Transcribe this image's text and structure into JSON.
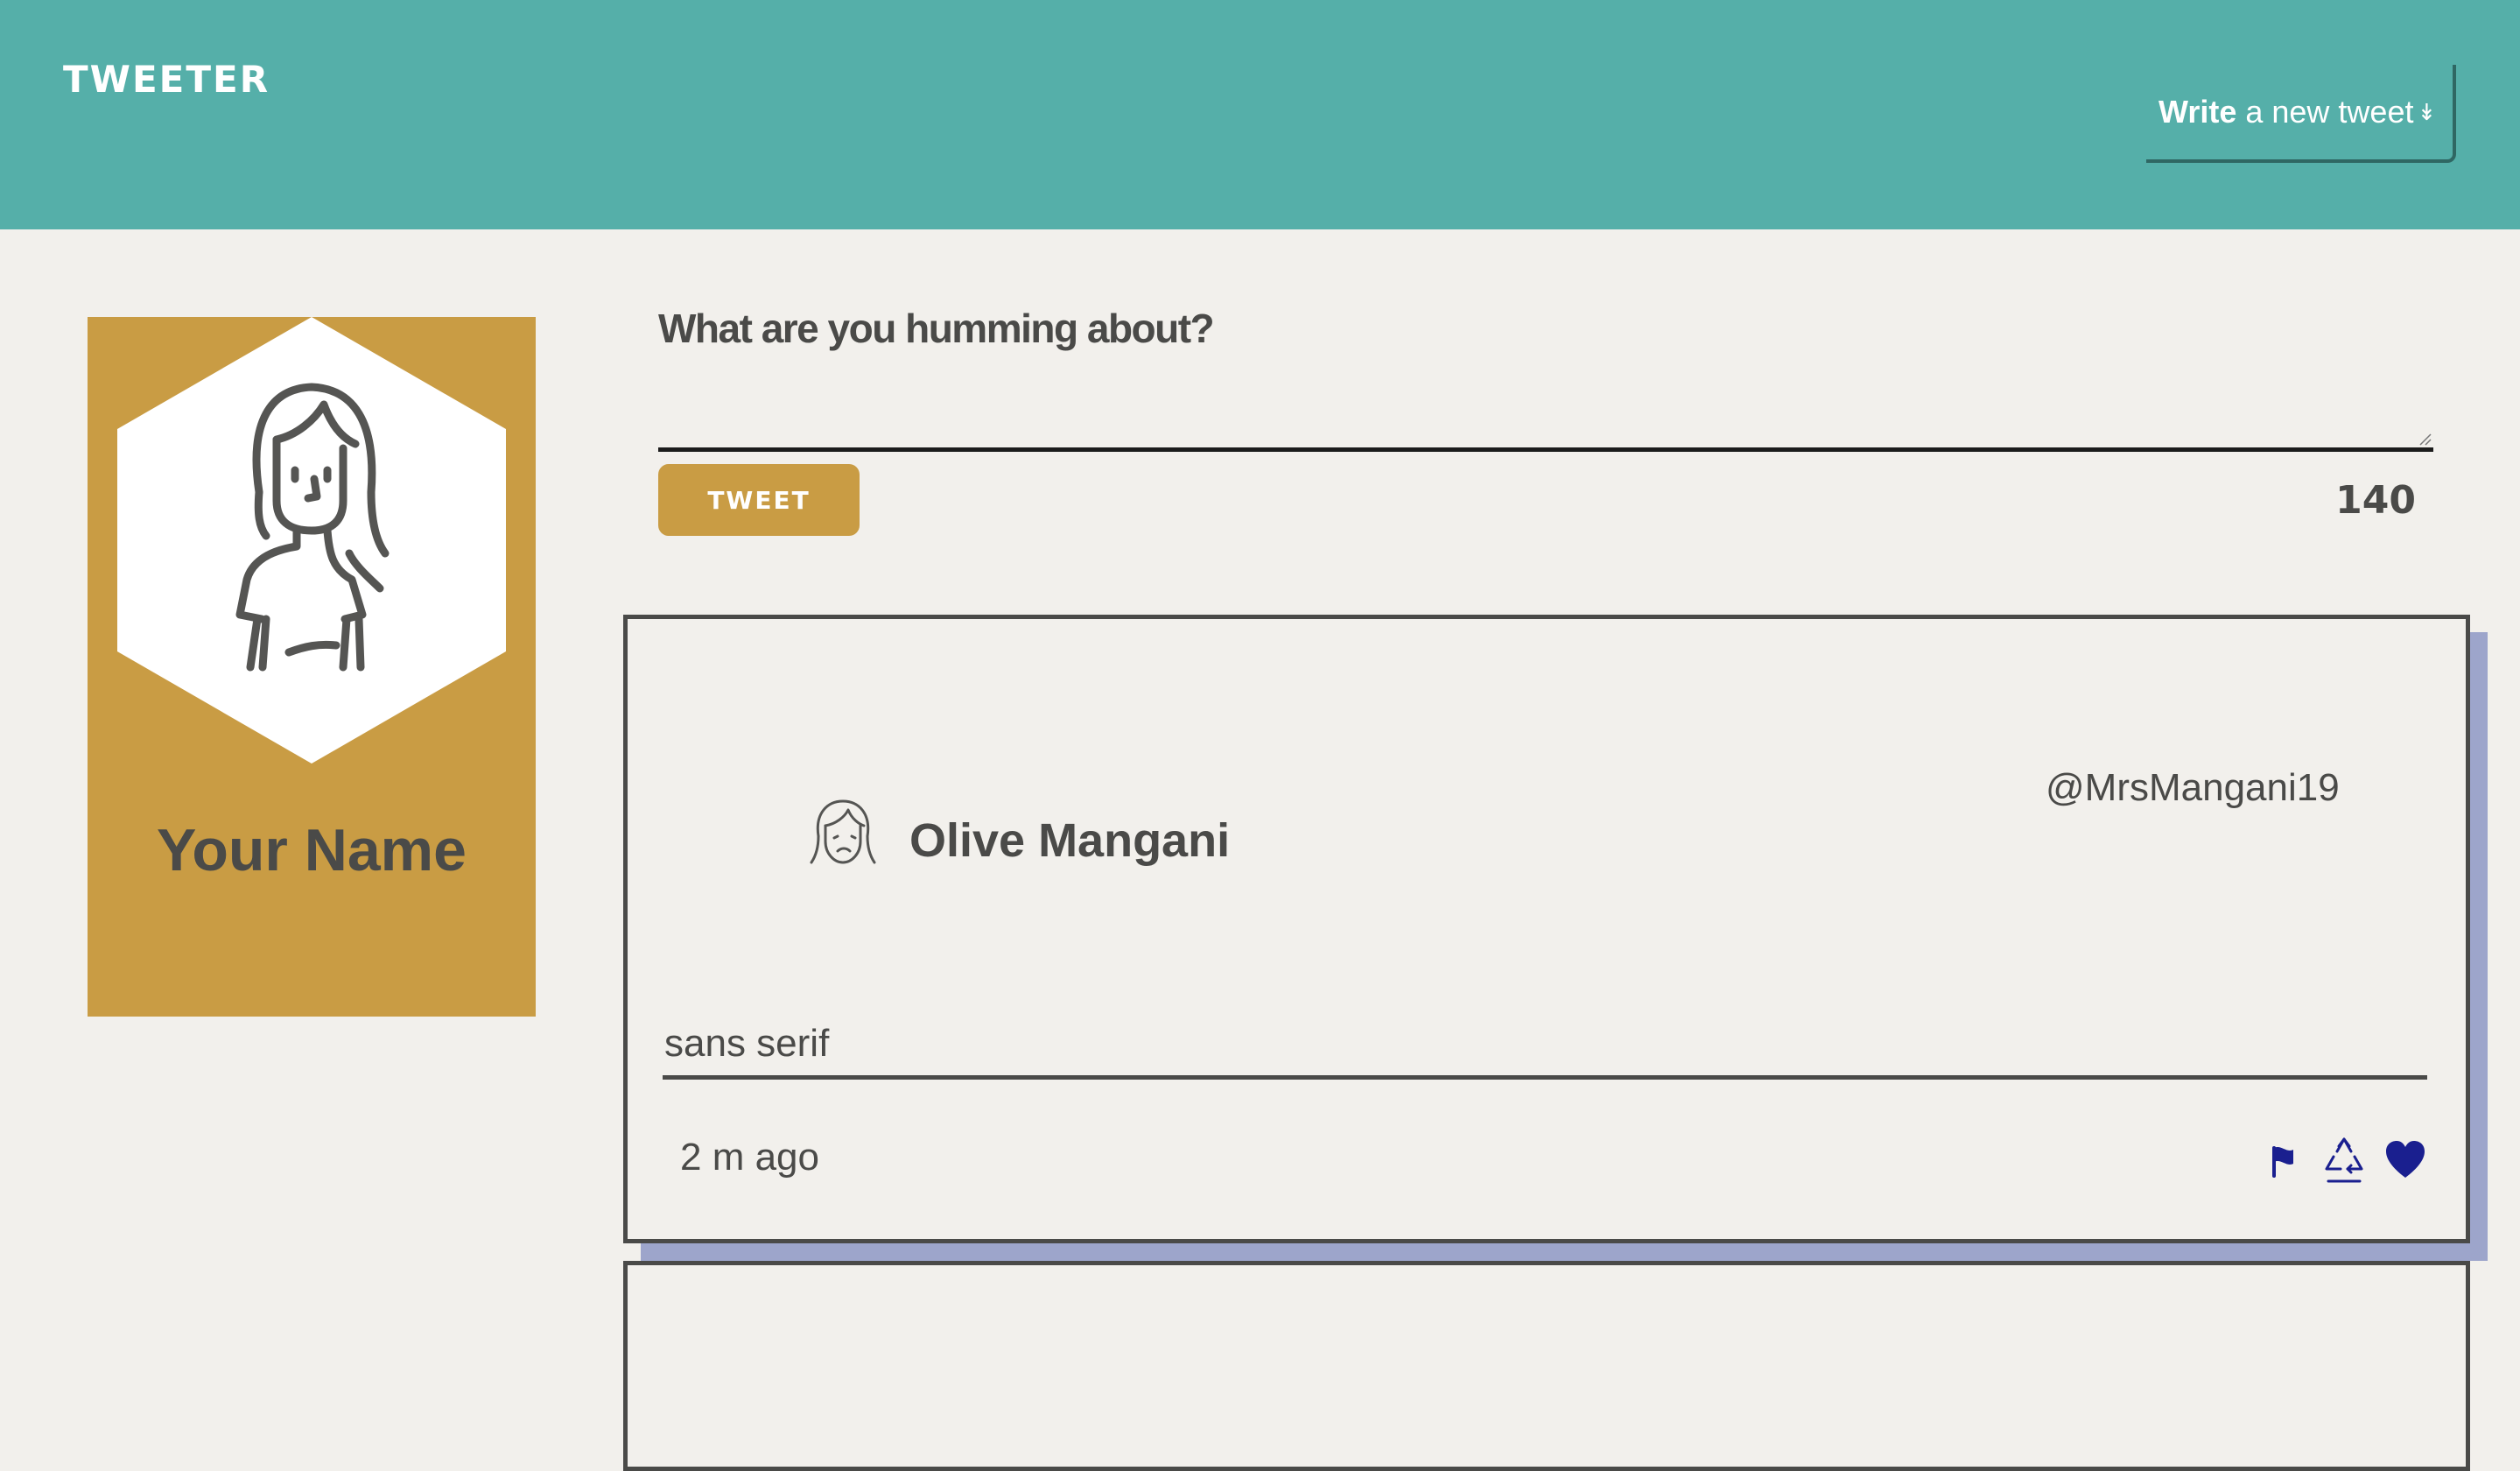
{
  "nav": {
    "brand": "TWEETER",
    "compose_toggle": {
      "strong": "Write",
      "rest": "a new tweet",
      "icon": "double-down-arrow-icon"
    }
  },
  "profile": {
    "avatar_icon": "woman-avatar-icon",
    "name": "Your Name"
  },
  "compose": {
    "prompt": "What are you humming about?",
    "text_value": "",
    "button_label": "TWEET",
    "counter": "140"
  },
  "tweets": [
    {
      "avatar_icon": "woman-face-icon",
      "name": "Olive Mangani",
      "handle": "@MrsMangani19",
      "content": "sans serif",
      "time": "2 m ago",
      "actions": [
        "flag-icon",
        "retweet-icon",
        "heart-icon"
      ]
    }
  ],
  "colors": {
    "nav": "#55afa9",
    "accent_gold": "#c99c44",
    "background": "#f2f0ec",
    "text": "#4a4a48",
    "shadow": "#9da5cb",
    "action_icons": "#1a1f8f"
  }
}
